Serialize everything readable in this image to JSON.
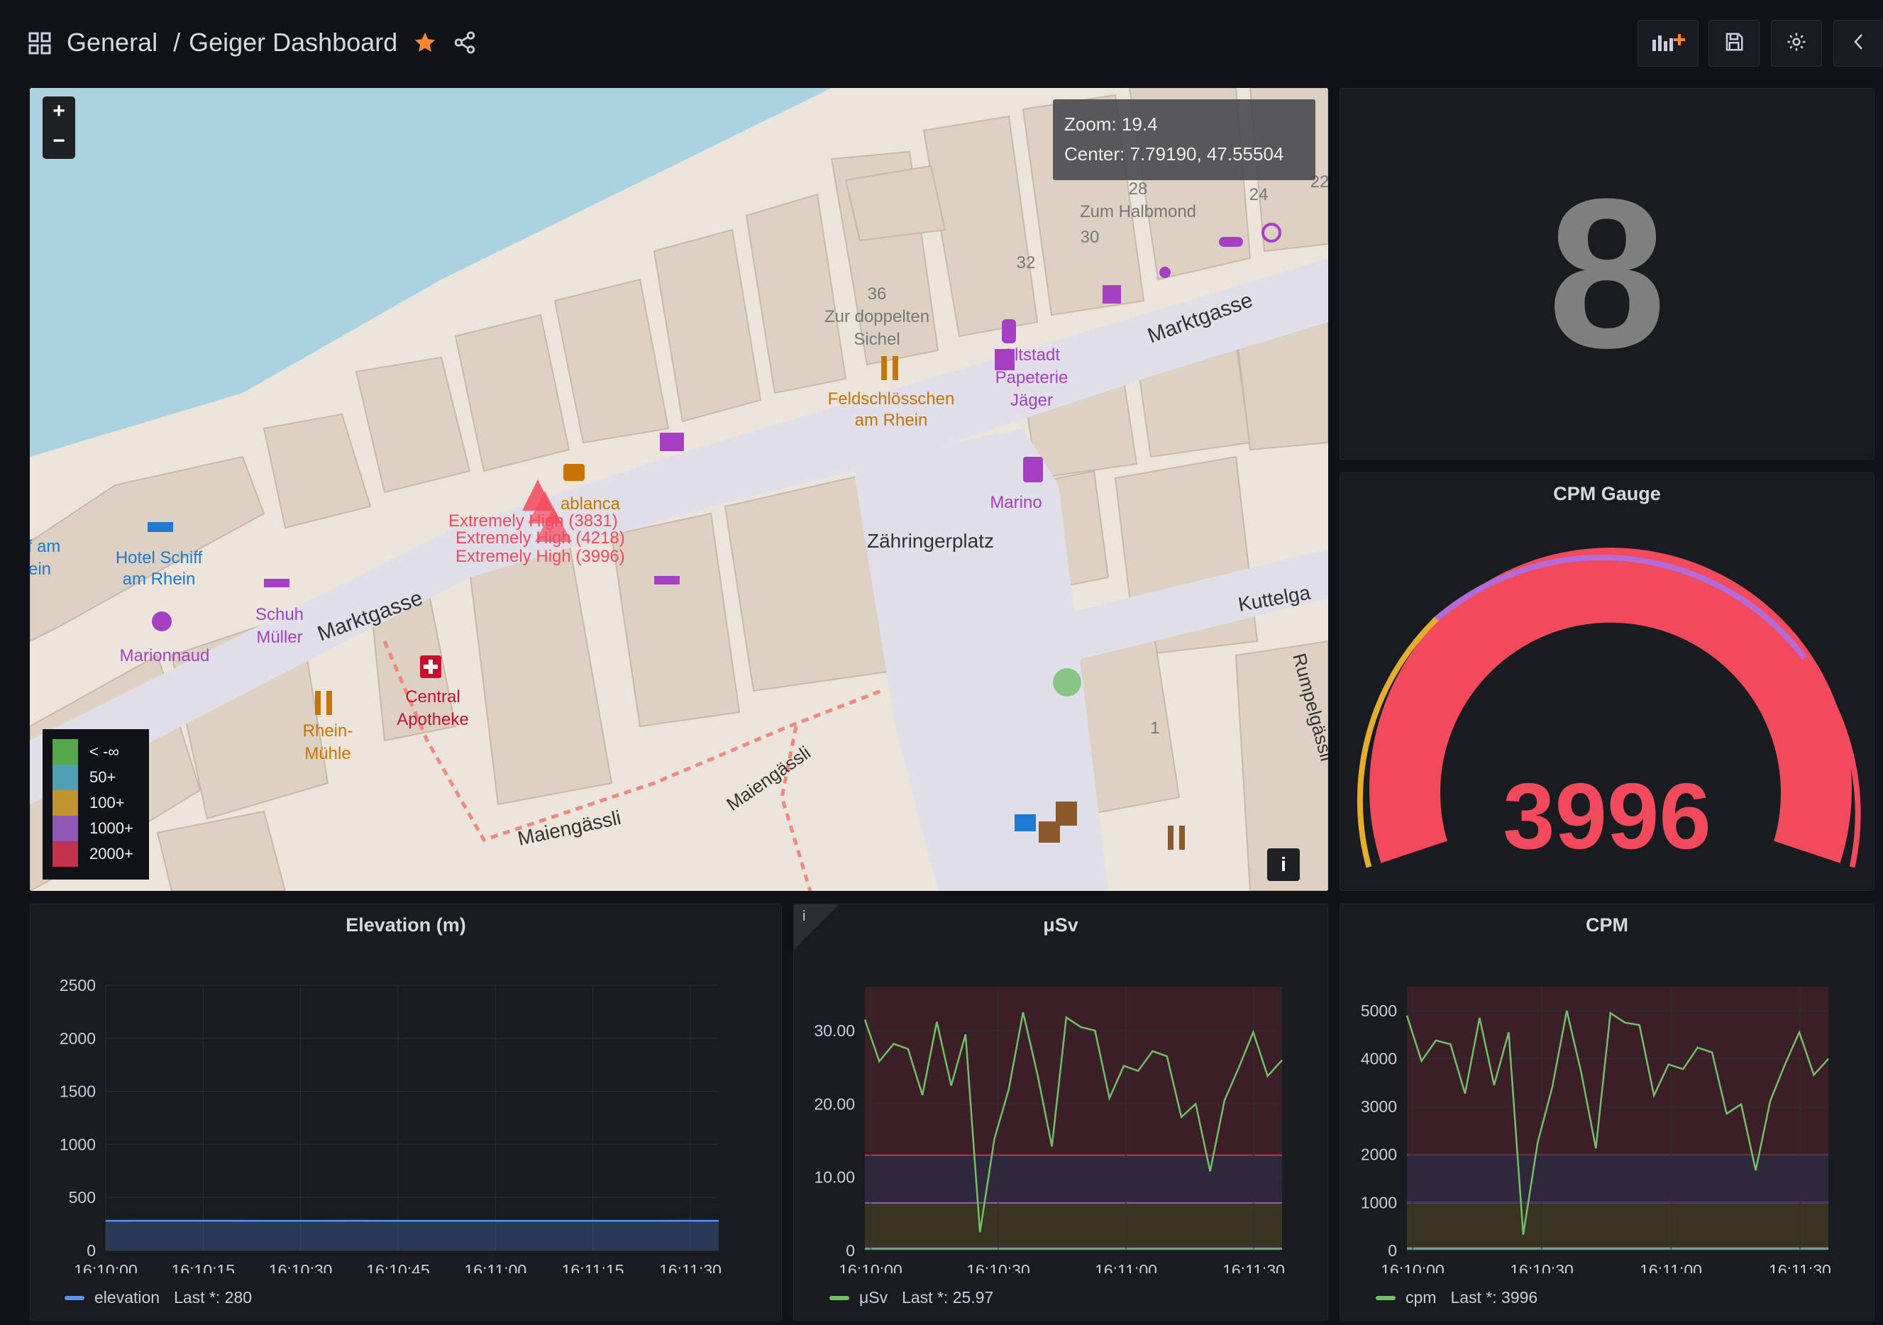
{
  "breadcrumb": {
    "folder": "General",
    "separator": "/",
    "dashboard": "Geiger Dashboard"
  },
  "map": {
    "zoom_label": "Zoom:",
    "zoom_value": "19.4",
    "center_label": "Center:",
    "center_value": "7.79190, 47.55504",
    "zoom_in": "+",
    "zoom_out": "−",
    "info_button": "i",
    "legend": [
      {
        "label": "< -∞",
        "color": "#56a64b"
      },
      {
        "label": "50+",
        "color": "#4ea1b5"
      },
      {
        "label": "100+",
        "color": "#c09530"
      },
      {
        "label": "1000+",
        "color": "#8e58b5"
      },
      {
        "label": "2000+",
        "color": "#c4314b"
      }
    ],
    "street_labels": [
      "Marktgasse",
      "Marktgasse",
      "Zähringerplatz",
      "Kuttelga",
      "Rumpelgässli",
      "Maiengässli",
      "Maiengässli"
    ],
    "poi_labels": [
      "Hotel Schiff",
      "am Rhein",
      "Schuh",
      "Müller",
      "Marionnaud",
      "Central",
      "Apotheke",
      "Rhein-",
      "Mühle",
      "Feldschlösschen",
      "am Rhein",
      "Altstadt",
      "Papeterie",
      "Jäger",
      "Marino",
      "Zum Halbmond",
      "Zur doppelten",
      "Sichel",
      "ablanca",
      "f am",
      "ein"
    ],
    "house_numbers": [
      "28",
      "24",
      "30",
      "32",
      "36",
      "1",
      "22"
    ],
    "marker_labels": [
      "Extremely High (3831)",
      "Extremely High (4218)",
      "Extremely High (3996)"
    ]
  },
  "stat_panel": {
    "value": "8"
  },
  "gauge_panel": {
    "title": "CPM Gauge",
    "value": "3996"
  },
  "elevation_panel": {
    "title": "Elevation (m)",
    "legend_name": "elevation",
    "legend_stat": "Last *: 280",
    "color": "#5794f2"
  },
  "usv_panel": {
    "title": "μSv",
    "info_icon": "i",
    "legend_name": "μSv",
    "legend_stat": "Last *: 25.97",
    "color": "#73bf69"
  },
  "cpm_panel": {
    "title": "CPM",
    "legend_name": "cpm",
    "legend_stat": "Last *: 3996",
    "color": "#73bf69"
  },
  "chart_data": [
    {
      "type": "area",
      "title": "Elevation (m)",
      "x": [
        "16:10:00",
        "16:10:15",
        "16:10:30",
        "16:10:45",
        "16:11:00",
        "16:11:15",
        "16:11:30"
      ],
      "xticks": [
        "16:10:00",
        "16:10:15",
        "16:10:30",
        "16:10:45",
        "16:11:00",
        "16:11:15",
        "16:11:30"
      ],
      "series": [
        {
          "name": "elevation",
          "values": [
            280,
            281,
            281,
            281,
            281,
            280,
            280,
            280,
            281,
            280,
            280,
            280,
            280,
            280,
            280,
            280,
            280,
            280,
            280,
            281,
            280
          ]
        }
      ],
      "yticks": [
        "0",
        "500",
        "1000",
        "1500",
        "2000",
        "2500"
      ],
      "ylim": [
        0,
        2500
      ],
      "grid": true,
      "legend": "bottom-left"
    },
    {
      "type": "line",
      "title": "μSv",
      "xticks": [
        "16:10:00",
        "16:10:30",
        "16:11:00",
        "16:11:30"
      ],
      "series": [
        {
          "name": "μSv",
          "values": [
            31.5,
            25.8,
            28.2,
            27.5,
            21.2,
            31.2,
            22.5,
            29.5,
            2.5,
            15.2,
            22,
            32.5,
            24,
            14.2,
            31.8,
            30.5,
            30,
            20.8,
            25.2,
            24.5,
            27.2,
            26.5,
            18.2,
            20,
            10.8,
            20.5,
            25,
            29.8,
            23.8,
            25.97
          ]
        }
      ],
      "yticks": [
        "0",
        "10.00",
        "20.00",
        "30.00"
      ],
      "ylim": [
        0,
        36
      ],
      "thresholds": [
        {
          "from": 13,
          "color": "#c4314b"
        },
        {
          "from": 6.5,
          "color": "#8e58b5"
        },
        {
          "from": 0.3,
          "color": "#c09530"
        }
      ],
      "grid": true,
      "legend": "bottom-left"
    },
    {
      "type": "line",
      "title": "CPM",
      "xticks": [
        "16:10:00",
        "16:10:30",
        "16:11:00",
        "16:11:30"
      ],
      "series": [
        {
          "name": "cpm",
          "values": [
            4900,
            3950,
            4380,
            4300,
            3270,
            4850,
            3450,
            4550,
            330,
            2250,
            3400,
            5000,
            3700,
            2130,
            4950,
            4750,
            4700,
            3230,
            3880,
            3780,
            4230,
            4130,
            2850,
            3050,
            1670,
            3120,
            3870,
            4550,
            3660,
            3996
          ]
        }
      ],
      "yticks": [
        "0",
        "1000",
        "2000",
        "3000",
        "4000",
        "5000"
      ],
      "ylim": [
        0,
        5500
      ],
      "thresholds": [
        {
          "from": 2000,
          "color": "#c4314b"
        },
        {
          "from": 1000,
          "color": "#8e58b5"
        },
        {
          "from": 50,
          "color": "#c09530"
        }
      ],
      "grid": true,
      "legend": "bottom-left"
    }
  ]
}
